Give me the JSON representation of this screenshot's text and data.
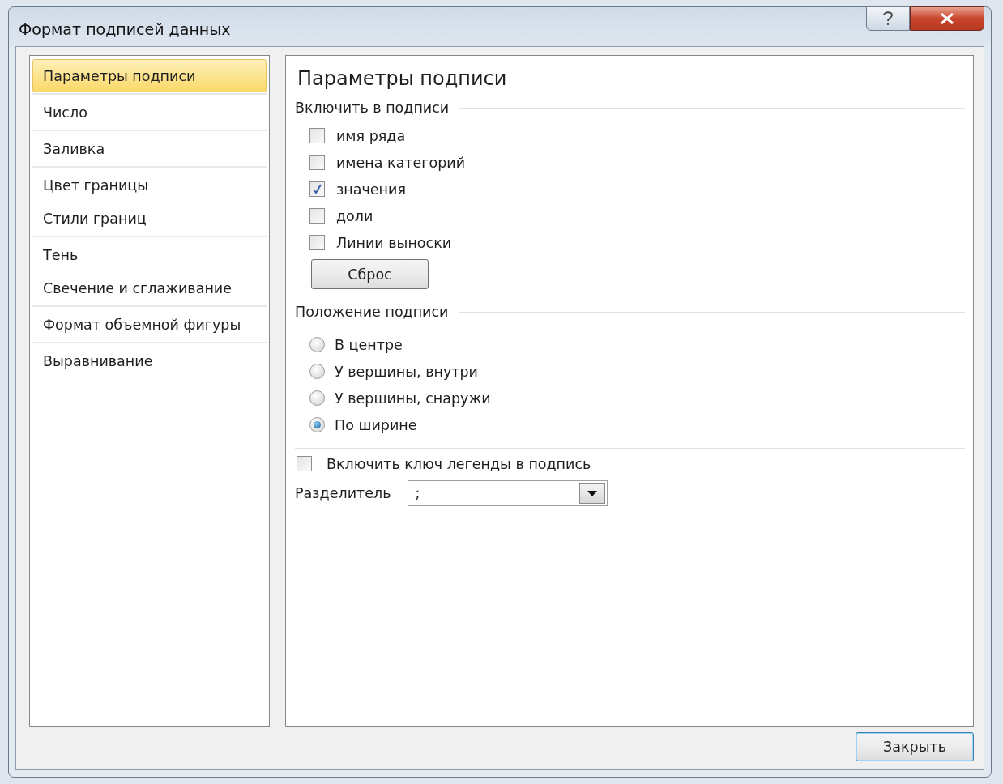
{
  "window": {
    "title": "Формат подписей данных"
  },
  "sidebar": {
    "groups": [
      {
        "items": [
          {
            "label": "Параметры подписи",
            "selected": true
          }
        ]
      },
      {
        "items": [
          {
            "label": "Число",
            "selected": false
          }
        ]
      },
      {
        "items": [
          {
            "label": "Заливка",
            "selected": false
          }
        ]
      },
      {
        "items": [
          {
            "label": "Цвет границы",
            "selected": false
          },
          {
            "label": "Стили границ",
            "selected": false
          }
        ]
      },
      {
        "items": [
          {
            "label": "Тень",
            "selected": false
          },
          {
            "label": "Свечение и сглаживание",
            "selected": false
          }
        ]
      },
      {
        "items": [
          {
            "label": "Формат объемной фигуры",
            "selected": false
          }
        ]
      },
      {
        "items": [
          {
            "label": "Выравнивание",
            "selected": false
          }
        ]
      }
    ]
  },
  "panel": {
    "title": "Параметры подписи",
    "include_section": {
      "heading": "Включить в подписи",
      "checkboxes": [
        {
          "label": "имя ряда",
          "checked": false
        },
        {
          "label": "имена категорий",
          "checked": false
        },
        {
          "label": "значения",
          "checked": true
        },
        {
          "label": "доли",
          "checked": false
        },
        {
          "label": "Линии выноски",
          "checked": false
        }
      ],
      "reset_button": "Сброс"
    },
    "position_section": {
      "heading": "Положение подписи",
      "radios": [
        {
          "label": "В центре",
          "selected": false
        },
        {
          "label": "У вершины, внутри",
          "selected": false
        },
        {
          "label": "У вершины, снаружи",
          "selected": false
        },
        {
          "label": "По ширине",
          "selected": true
        }
      ]
    },
    "legend_key": {
      "label": "Включить ключ легенды в подпись",
      "checked": false
    },
    "separator": {
      "label": "Разделитель",
      "value": ";"
    }
  },
  "close_button": "Закрыть"
}
